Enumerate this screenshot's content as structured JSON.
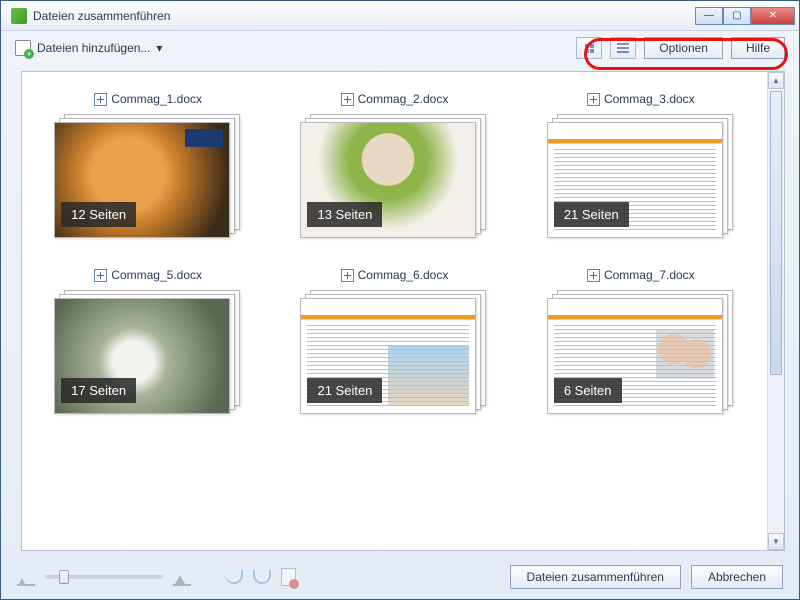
{
  "window": {
    "title": "Dateien zusammenführen"
  },
  "toolbar": {
    "add_files": "Dateien hinzufügen...",
    "options": "Optionen",
    "help": "Hilfe"
  },
  "files": [
    {
      "name": "Commag_1.docx",
      "pages_label": "12 Seiten",
      "thumb": "t1"
    },
    {
      "name": "Commag_2.docx",
      "pages_label": "13 Seiten",
      "thumb": "t2"
    },
    {
      "name": "Commag_3.docx",
      "pages_label": "21 Seiten",
      "thumb": "t3"
    },
    {
      "name": "Commag_5.docx",
      "pages_label": "17 Seiten",
      "thumb": "t5"
    },
    {
      "name": "Commag_6.docx",
      "pages_label": "21 Seiten",
      "thumb": "t6"
    },
    {
      "name": "Commag_7.docx",
      "pages_label": "6 Seiten",
      "thumb": "t7"
    }
  ],
  "buttons": {
    "combine": "Dateien zusammenführen",
    "cancel": "Abbrechen"
  }
}
